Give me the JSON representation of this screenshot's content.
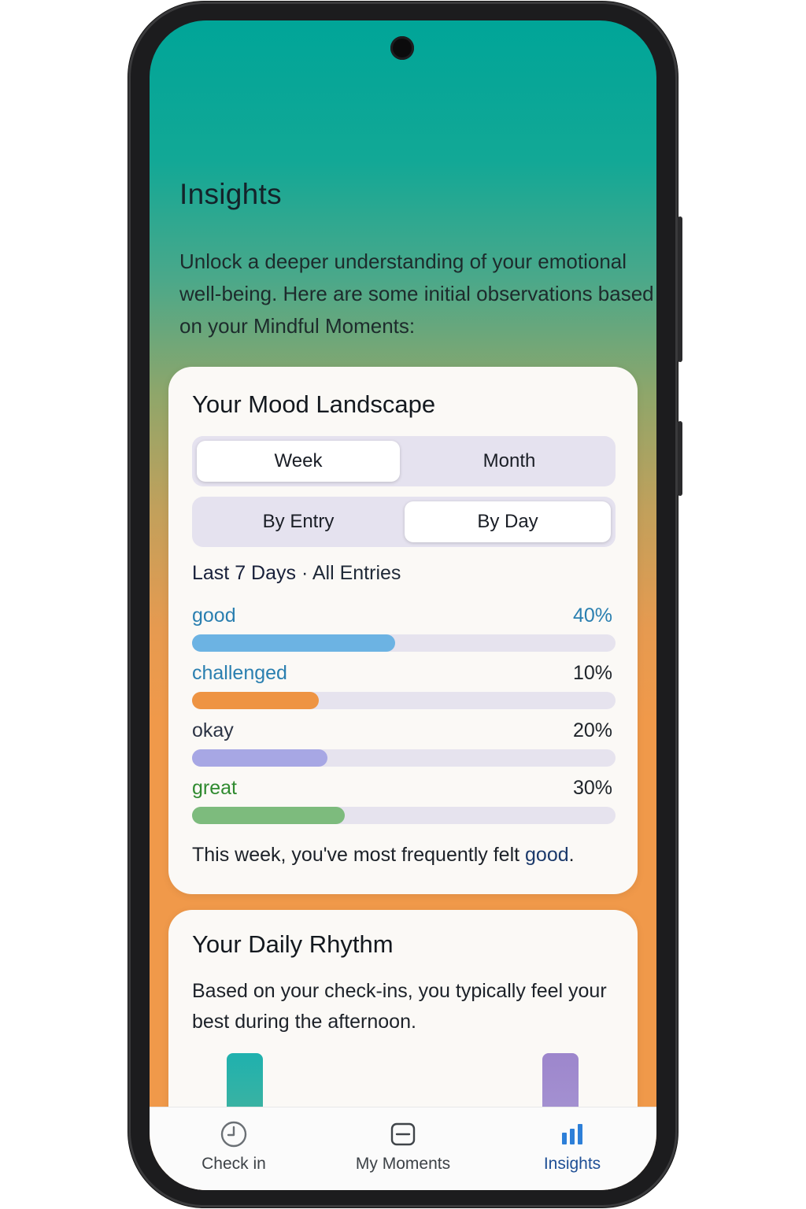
{
  "header": {
    "title": "Insights",
    "intro": "Unlock a deeper understanding of your emotional well-being. Here are some initial observations based on your Mindful Moments:"
  },
  "mood_card": {
    "title": "Your Mood Landscape",
    "period_toggle": {
      "options": [
        "Week",
        "Month"
      ],
      "selected": "Week"
    },
    "grouping_toggle": {
      "options": [
        "By Entry",
        "By Day"
      ],
      "selected": "By Day"
    },
    "range_label": "Last 7 Days",
    "range_separator": " · ",
    "range_filter": "All Entries",
    "moods": [
      {
        "label": "good",
        "percent_label": "40%",
        "percent": 48,
        "color": "#6cb3e3",
        "label_color": "#2a7fb0",
        "pct_color": "#2a7fb0"
      },
      {
        "label": "challenged",
        "percent_label": "10%",
        "percent": 30,
        "color": "#ee9443",
        "label_color": "#2a7fb0",
        "pct_color": "#20252b"
      },
      {
        "label": "okay",
        "percent_label": "20%",
        "percent": 32,
        "color": "#a7a7e4",
        "label_color": "#2c3445",
        "pct_color": "#20252b"
      },
      {
        "label": "great",
        "percent_label": "30%",
        "percent": 36,
        "color": "#7dbb7d",
        "label_color": "#2f8a2f",
        "pct_color": "#20252b"
      }
    ],
    "summary_prefix": "This week, you've most frequently felt ",
    "summary_mood": "good",
    "summary_suffix": "."
  },
  "rhythm_card": {
    "title": "Your Daily Rhythm",
    "text": "Based on your check-ins, you typically feel your best during the afternoon.",
    "bar_colors": [
      "#1fb1ae",
      "#9d86cc"
    ]
  },
  "tabbar": {
    "tabs": [
      {
        "label": "Check in",
        "icon": "clock-icon"
      },
      {
        "label": "My Moments",
        "icon": "journal-icon"
      },
      {
        "label": "Insights",
        "icon": "bar-chart-icon"
      }
    ],
    "active": "Insights",
    "active_color": "#1f4f95"
  }
}
